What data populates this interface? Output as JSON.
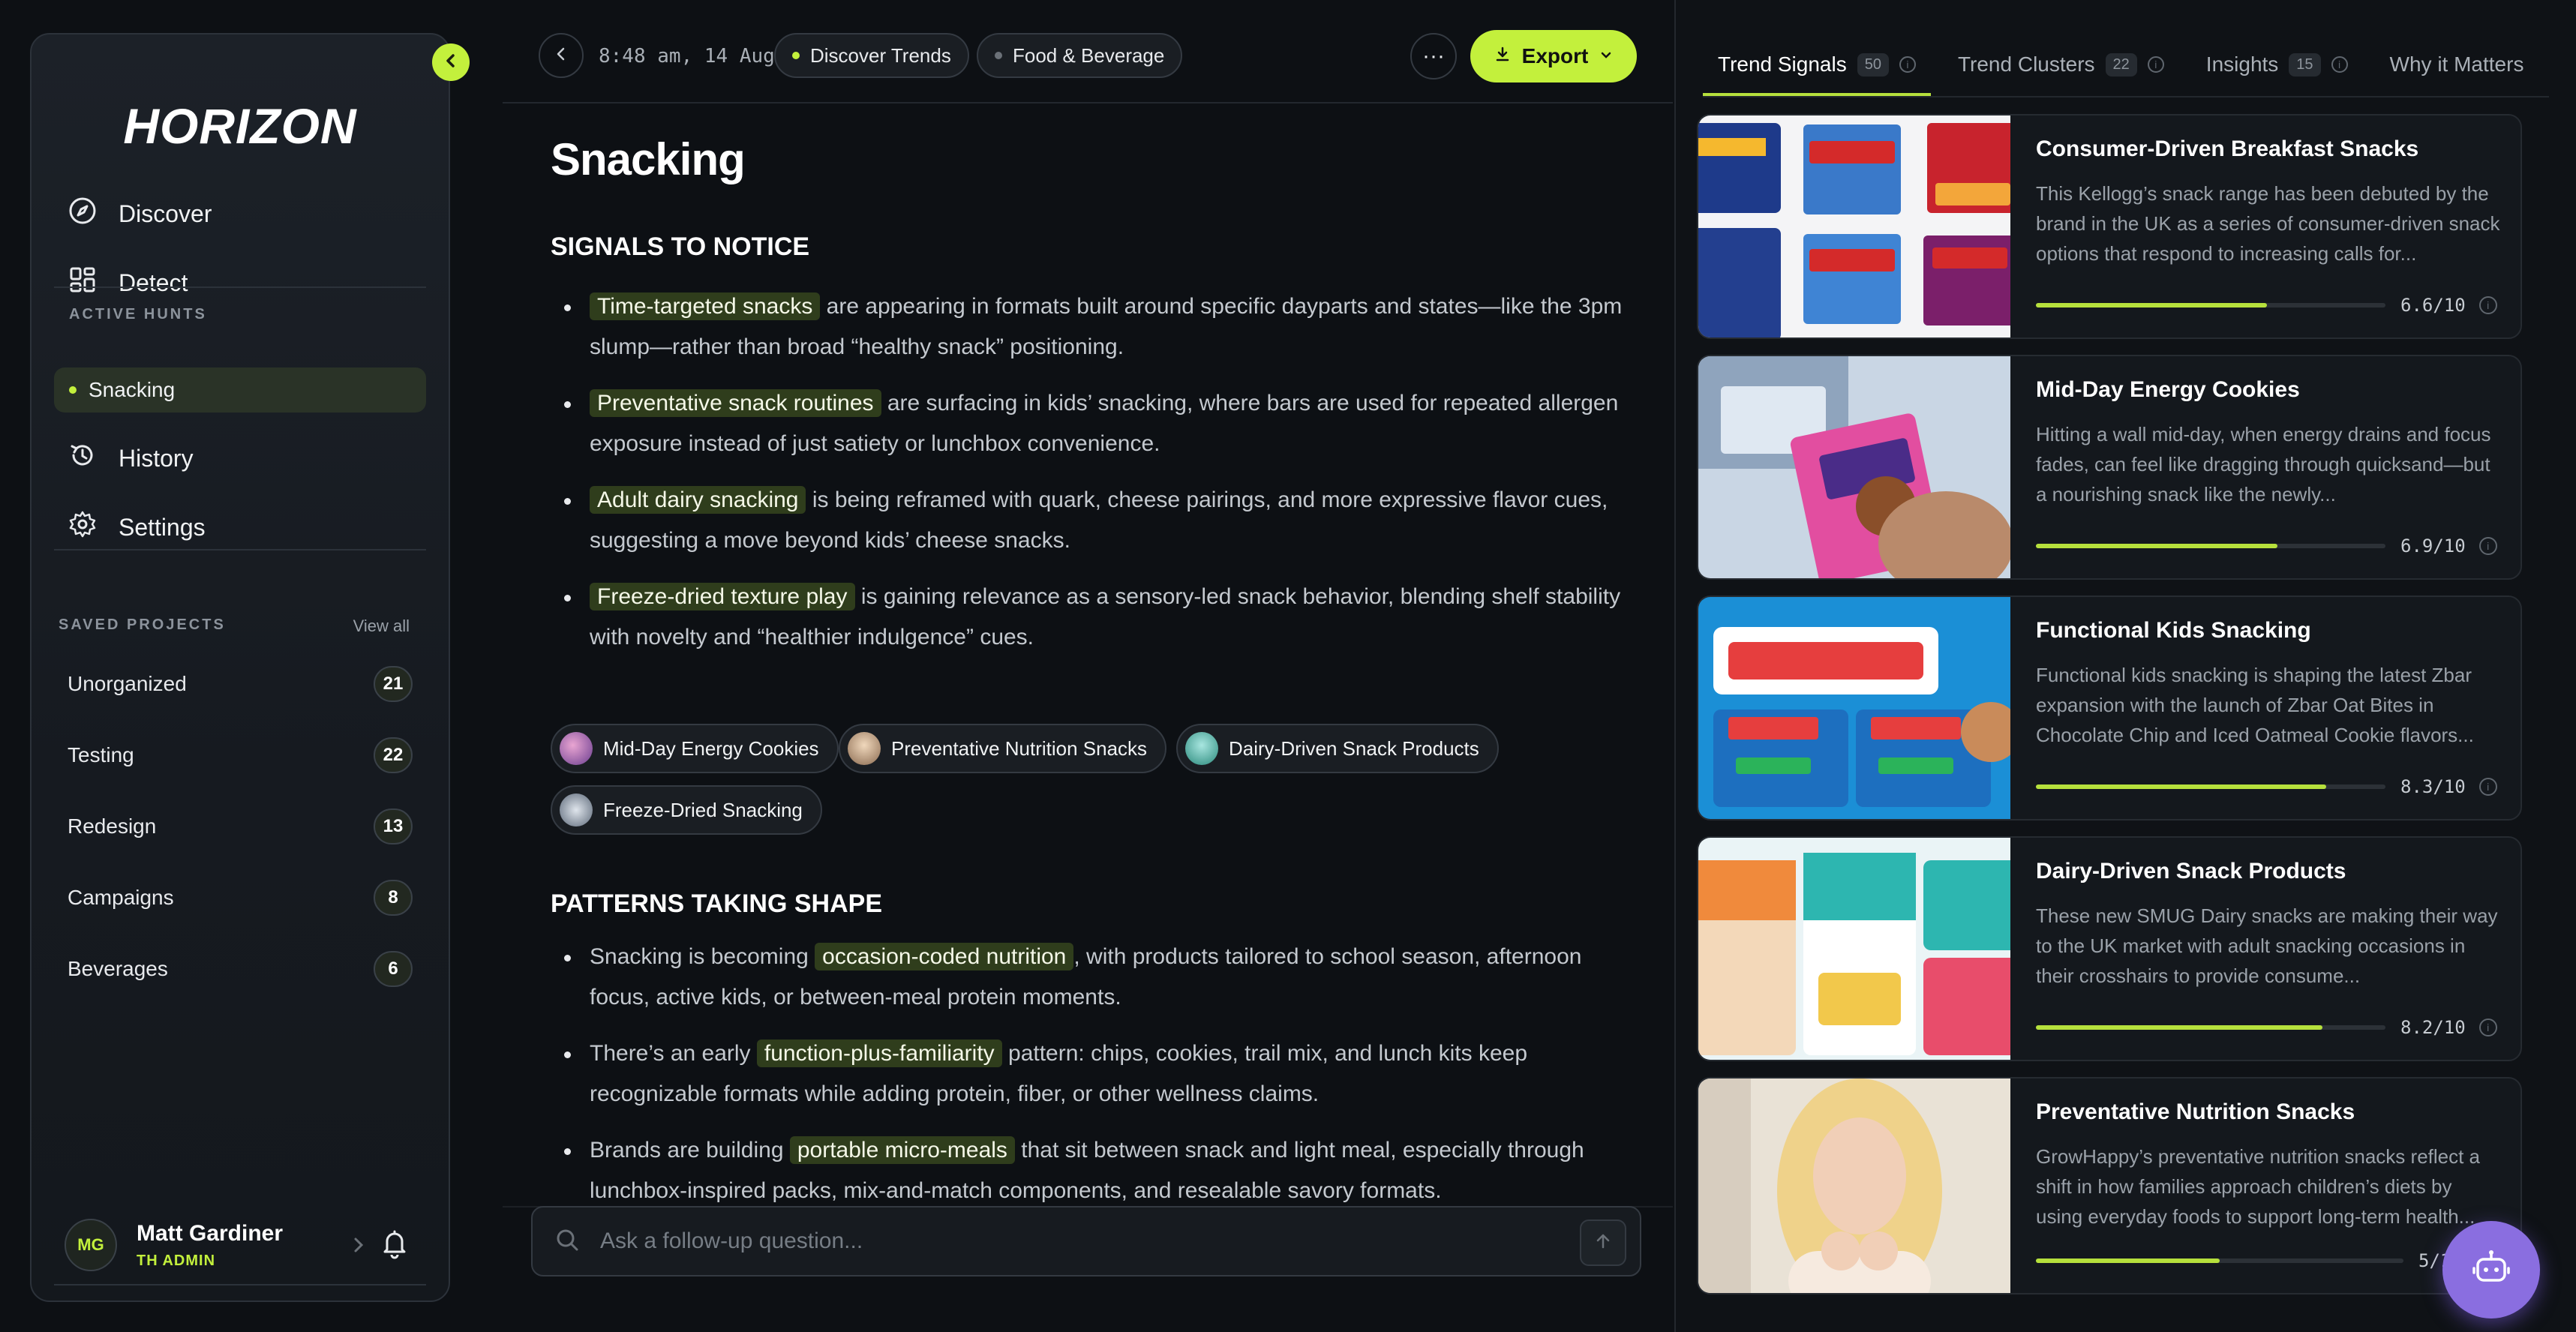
{
  "sidebar": {
    "logo": "HORIZON",
    "nav": [
      {
        "label": "Discover",
        "icon": "compass-icon"
      },
      {
        "label": "Detect",
        "icon": "grid-icon"
      }
    ],
    "active_hunts_label": "ACTIVE HUNTS",
    "active_hunt": "Snacking",
    "nav2": [
      {
        "label": "History",
        "icon": "history-icon"
      },
      {
        "label": "Settings",
        "icon": "gear-icon"
      }
    ],
    "saved_projects_label": "SAVED PROJECTS",
    "view_all": "View all",
    "projects": [
      {
        "name": "Unorganized",
        "count": "21"
      },
      {
        "name": "Testing",
        "count": "22"
      },
      {
        "name": "Redesign",
        "count": "13"
      },
      {
        "name": "Campaigns",
        "count": "8"
      },
      {
        "name": "Beverages",
        "count": "6"
      }
    ],
    "user": {
      "initials": "MG",
      "name": "Matt Gardiner",
      "role": "TH ADMIN"
    }
  },
  "topbar": {
    "timestamp": "8:48 am, 14 Aug",
    "chips": [
      "Discover Trends",
      "Food & Beverage"
    ],
    "more": "···",
    "export_label": "Export"
  },
  "main": {
    "title": "Snacking",
    "signals_heading": "SIGNALS TO NOTICE",
    "signals": [
      {
        "hl": "Time-targeted snacks",
        "rest": " are appearing in formats built around specific dayparts and states—like the 3pm slump—rather than broad “healthy snack” positioning."
      },
      {
        "hl": "Preventative snack routines",
        "rest": " are surfacing in kids’ snacking, where bars are used for repeated allergen exposure instead of just satiety or lunchbox convenience."
      },
      {
        "hl": "Adult dairy snacking",
        "rest": " is being reframed with quark, cheese pairings, and more expressive flavor cues, suggesting a move beyond kids’ cheese snacks."
      },
      {
        "hl": "Freeze-dried texture play",
        "rest": " is gaining relevance as a sensory-led snack behavior, blending shelf stability with novelty and “healthier indulgence” cues."
      }
    ],
    "pills": [
      "Mid-Day Energy Cookies",
      "Preventative Nutrition Snacks",
      "Dairy-Driven Snack Products",
      "Freeze-Dried Snacking"
    ],
    "patterns_heading": "PATTERNS TAKING SHAPE",
    "patterns": [
      {
        "pre": "Snacking is becoming ",
        "hl": "occasion-coded nutrition",
        "post": ", with products tailored to school season, afternoon focus, active kids, or between-meal protein moments."
      },
      {
        "pre": "There’s an early ",
        "hl": "function-plus-familiarity",
        "post": " pattern: chips, cookies, trail mix, and lunch kits keep recognizable formats while adding protein, fiber, or other wellness claims."
      },
      {
        "pre": "Brands are building ",
        "hl": "portable micro-meals",
        "post": " that sit between snack and light meal, especially through lunchbox-inspired packs, mix-and-match components, and resealable savory formats."
      }
    ],
    "followup_placeholder": "Ask a follow-up question..."
  },
  "right": {
    "tabs": [
      {
        "label": "Trend Signals",
        "count": "50"
      },
      {
        "label": "Trend Clusters",
        "count": "22"
      },
      {
        "label": "Insights",
        "count": "15"
      },
      {
        "label": "Why it Matters",
        "count": ""
      }
    ],
    "cards": [
      {
        "title": "Consumer-Driven Breakfast Snacks",
        "desc": "This Kellogg’s snack range has been debuted by the brand in the UK as a series of consumer-driven snack options that respond to increasing calls for...",
        "score_value": 6.6,
        "score": "6.6/10"
      },
      {
        "title": "Mid-Day Energy Cookies",
        "desc": "Hitting a wall mid-day, when energy drains and focus fades, can feel like dragging through quicksand—but a nourishing snack like the newly...",
        "score_value": 6.9,
        "score": "6.9/10"
      },
      {
        "title": "Functional Kids Snacking",
        "desc": "Functional kids snacking is shaping the latest Zbar expansion with the launch of Zbar Oat Bites in Chocolate Chip and Iced Oatmeal Cookie flavors...",
        "score_value": 8.3,
        "score": "8.3/10"
      },
      {
        "title": "Dairy-Driven Snack Products",
        "desc": "These new SMUG Dairy snacks are making their way to the UK market with adult snacking occasions in their crosshairs to provide consume...",
        "score_value": 8.2,
        "score": "8.2/10"
      },
      {
        "title": "Preventative Nutrition Snacks",
        "desc": "GrowHappy’s preventative nutrition snacks reflect a shift in how families approach children’s diets by using everyday foods to support long-term health...",
        "score_value": 5,
        "score": "5/10"
      }
    ]
  }
}
